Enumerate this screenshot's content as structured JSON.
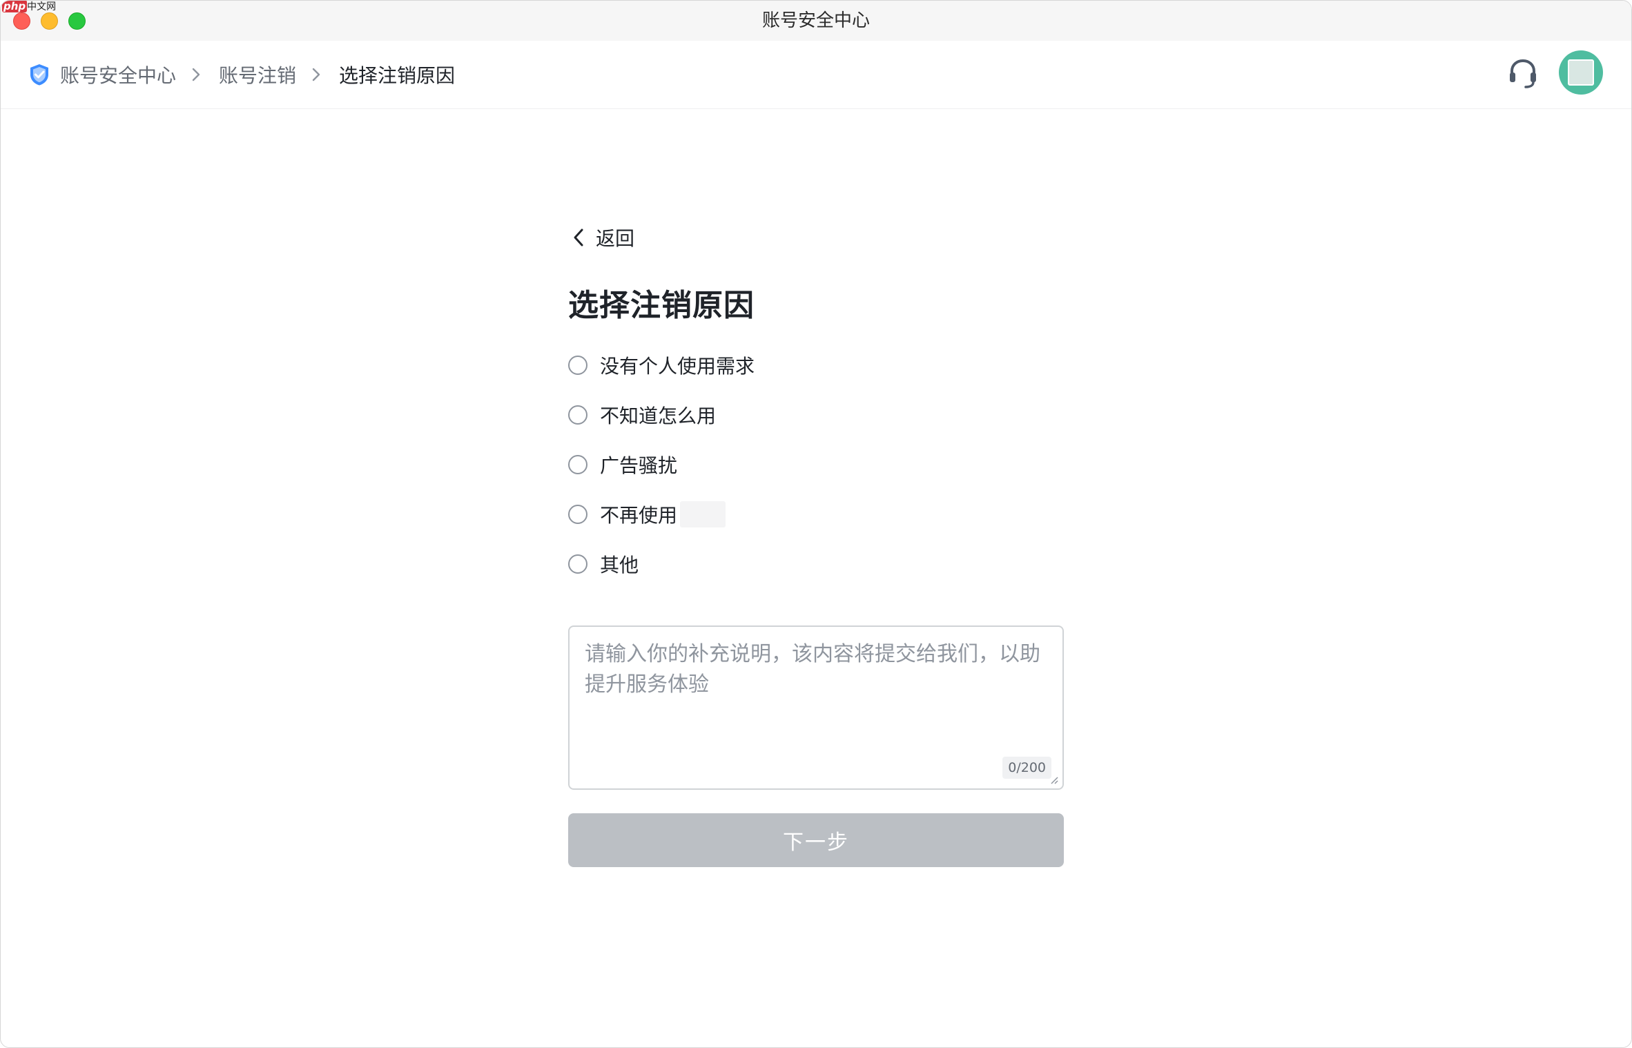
{
  "window": {
    "title": "账号安全中心",
    "watermark_a": "php",
    "watermark_b": "中文网"
  },
  "breadcrumb": {
    "items": [
      {
        "label": "账号安全中心"
      },
      {
        "label": "账号注销"
      },
      {
        "label": "选择注销原因"
      }
    ]
  },
  "header": {
    "support_icon": "headset-icon",
    "avatar_color": "#4fbda0"
  },
  "main": {
    "back_label": "返回",
    "title": "选择注销原因",
    "reasons": [
      {
        "label": "没有个人使用需求"
      },
      {
        "label": "不知道怎么用"
      },
      {
        "label": "广告骚扰"
      },
      {
        "label": "不再使用"
      },
      {
        "label": "其他"
      }
    ],
    "textarea_placeholder": "请输入你的补充说明，该内容将提交给我们，以助提升服务体验",
    "textarea_value": "",
    "counter": "0/200",
    "next_button": "下一步"
  },
  "colors": {
    "accent": "#3370ff",
    "disabled_button": "#bbbfc4",
    "text_primary": "#1f2329",
    "text_secondary": "#646a73"
  }
}
